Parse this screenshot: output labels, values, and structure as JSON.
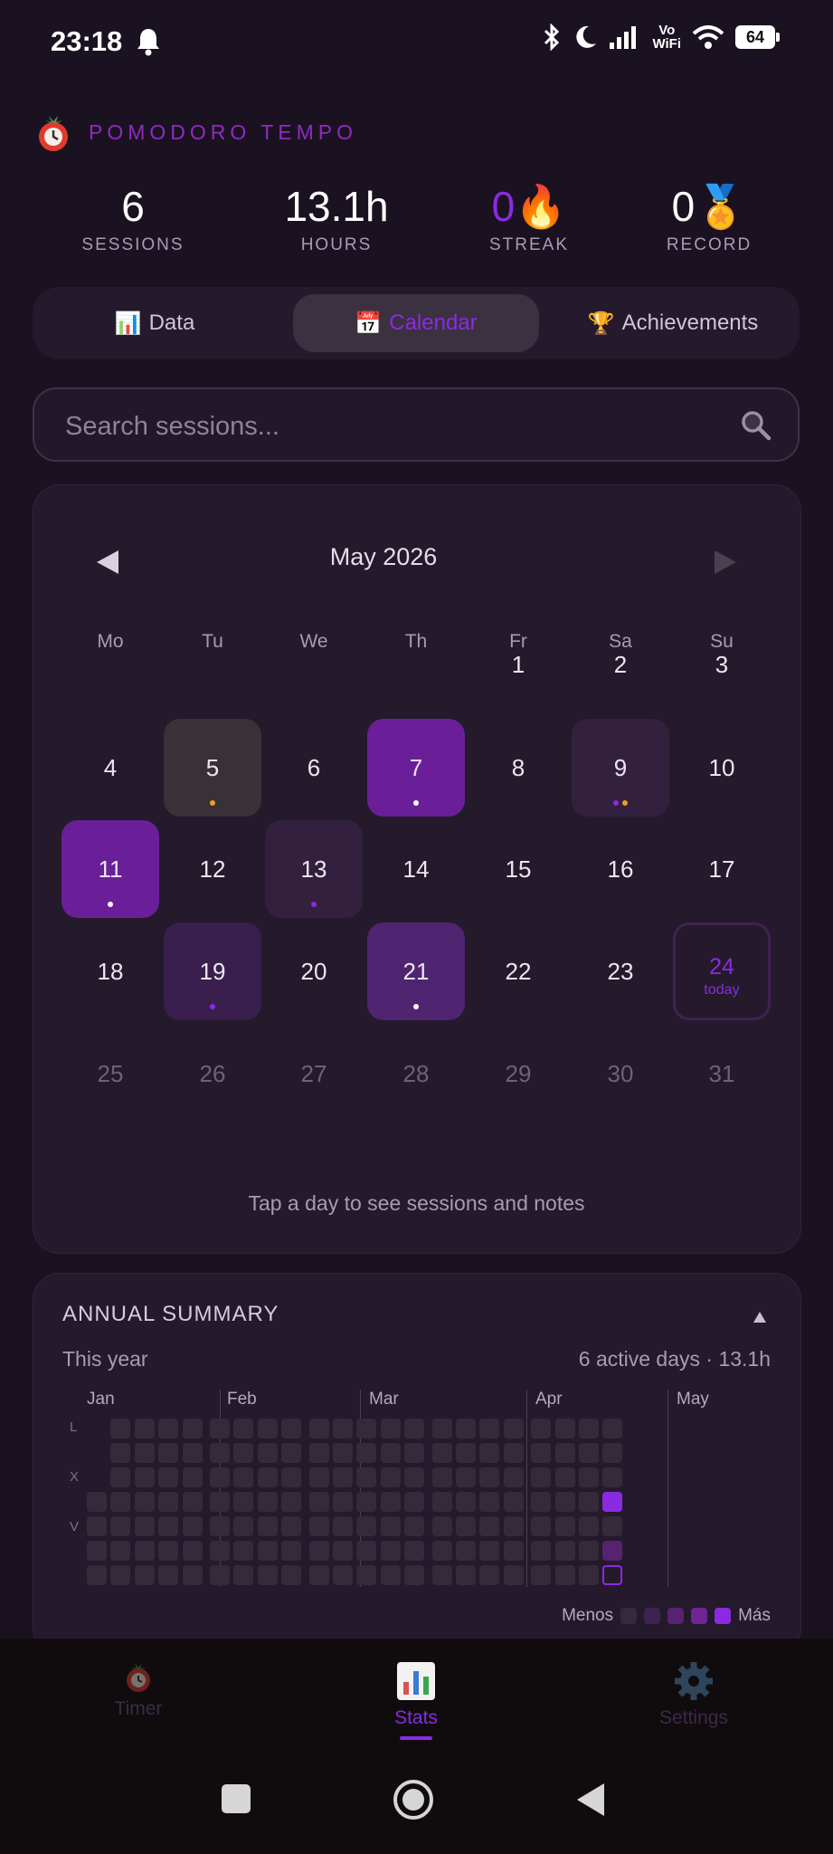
{
  "status_bar": {
    "time": "23:18",
    "network": "Vo\nWiFi",
    "battery": "64"
  },
  "header": {
    "app_title": "POMODORO TEMPO"
  },
  "stats": {
    "sessions": {
      "value": "6",
      "label": "SESSIONS"
    },
    "hours": {
      "value": "13.1h",
      "label": "HOURS"
    },
    "streak": {
      "value": "0",
      "emoji": "🔥",
      "label": "STREAK"
    },
    "record": {
      "value": "0",
      "emoji": "🏅",
      "label": "RECORD"
    }
  },
  "tabs": [
    {
      "icon": "📊",
      "label": "Data"
    },
    {
      "icon": "📅",
      "label": "Calendar",
      "active": true
    },
    {
      "icon": "🏆",
      "label": "Achievements"
    }
  ],
  "search": {
    "placeholder": "Search sessions..."
  },
  "calendar": {
    "month": "May 2026",
    "weekdays": [
      "Mo",
      "Tu",
      "We",
      "Th",
      "Fr",
      "Sa",
      "Su"
    ],
    "today_label": "today",
    "hint": "Tap a day to see sessions and notes",
    "days": [
      {
        "d": "1"
      },
      {
        "d": "2"
      },
      {
        "d": "3"
      },
      {
        "d": "4"
      },
      {
        "d": "5",
        "bg": "#3a3038",
        "dots": [
          "#f0a020"
        ]
      },
      {
        "d": "6"
      },
      {
        "d": "7",
        "bg": "#6a1f99",
        "dots": [
          "#ffffff"
        ]
      },
      {
        "d": "8"
      },
      {
        "d": "9",
        "bg": "#33203e",
        "dots": [
          "#8a2be2",
          "#f0a020"
        ]
      },
      {
        "d": "10"
      },
      {
        "d": "11",
        "bg": "#6a1f99",
        "dots": [
          "#ffffff"
        ]
      },
      {
        "d": "12"
      },
      {
        "d": "13",
        "bg": "#33203e",
        "dots": [
          "#8a2be2"
        ]
      },
      {
        "d": "14"
      },
      {
        "d": "15"
      },
      {
        "d": "16"
      },
      {
        "d": "17"
      },
      {
        "d": "18"
      },
      {
        "d": "19",
        "bg": "#3a1f4e",
        "dots": [
          "#8a2be2"
        ]
      },
      {
        "d": "20"
      },
      {
        "d": "21",
        "bg": "#4f2470",
        "dots": [
          "#ffffff"
        ]
      },
      {
        "d": "22"
      },
      {
        "d": "23"
      },
      {
        "d": "24",
        "today": true
      },
      {
        "d": "25",
        "other": true
      },
      {
        "d": "26",
        "other": true
      },
      {
        "d": "27",
        "other": true
      },
      {
        "d": "28",
        "other": true
      },
      {
        "d": "29",
        "other": true
      },
      {
        "d": "30",
        "other": true
      },
      {
        "d": "31",
        "other": true
      }
    ]
  },
  "annual": {
    "title": "ANNUAL SUMMARY",
    "period": "This year",
    "summary": "6 active days · 13.1h",
    "months": [
      "Jan",
      "Feb",
      "Mar",
      "Apr",
      "May"
    ],
    "weekday_labels": [
      "L",
      "X",
      "V"
    ],
    "legend_less": "Menos",
    "legend_more": "Más",
    "legend_colors": [
      "#342a39",
      "#3e2254",
      "#55236f",
      "#6f2596",
      "#8a2be2"
    ],
    "active_cells": [
      {
        "week": 21,
        "day": 5,
        "color": "#55236f"
      },
      {
        "week": 22,
        "day": 0,
        "color": "#8a2be2"
      },
      {
        "week": 22,
        "day": 2,
        "color": "#3e2254"
      },
      {
        "week": 23,
        "day": 1,
        "color": "#55236f"
      },
      {
        "week": 21,
        "day": 3,
        "color": "#8a2be2"
      },
      {
        "week": 23,
        "day": 3,
        "color": "#8a2be2"
      }
    ]
  },
  "bottom_nav": [
    {
      "icon": "timer-icon",
      "label": "Timer"
    },
    {
      "icon": "chart-icon",
      "label": "Stats",
      "active": true
    },
    {
      "icon": "gear-icon",
      "label": "Settings"
    }
  ]
}
